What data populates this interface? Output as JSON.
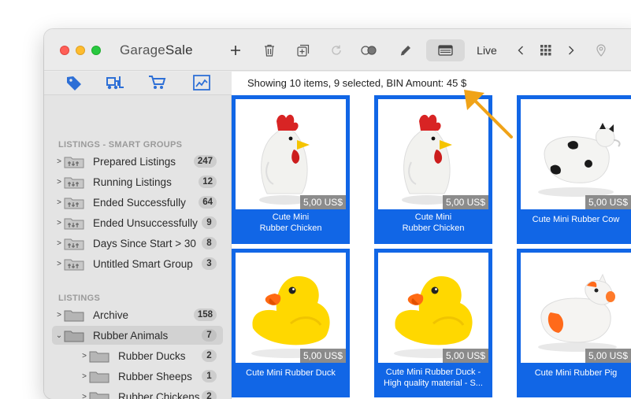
{
  "app": {
    "title_light": "Garage",
    "title_bold": "Sale",
    "live_label": "Live"
  },
  "toolbar": {
    "icons": [
      "plus-icon",
      "trash-icon",
      "duplicate-icon",
      "refresh-icon",
      "toggle-icon",
      "pencil-icon",
      "view-icon",
      "chevron-left-icon",
      "grid-icon",
      "chevron-right-icon",
      "location-icon"
    ]
  },
  "sidebar": {
    "tabs": [
      "tag-icon",
      "forklift-icon",
      "cart-icon",
      "chart-icon"
    ],
    "smart_groups_header": "LISTINGS - SMART GROUPS",
    "smart_groups": [
      {
        "label": "Prepared Listings",
        "count": "247"
      },
      {
        "label": "Running Listings",
        "count": "12"
      },
      {
        "label": "Ended Successfully",
        "count": "64"
      },
      {
        "label": "Ended Unsuccessfully",
        "count": "9"
      },
      {
        "label": "Days Since Start > 30",
        "count": "8"
      },
      {
        "label": "Untitled Smart Group",
        "count": "3"
      }
    ],
    "listings_header": "LISTINGS",
    "listings": [
      {
        "label": "Archive",
        "count": "158"
      },
      {
        "label": "Rubber Animals",
        "count": "7"
      }
    ],
    "subfolders": [
      {
        "label": "Rubber Ducks",
        "count": "2"
      },
      {
        "label": "Rubber Sheeps",
        "count": "1"
      },
      {
        "label": "Rubber Chickens",
        "count": "2"
      }
    ]
  },
  "main": {
    "status": "Showing 10 items, 9 selected, BIN Amount: 45 $",
    "items": [
      {
        "title_line1": "Cute Mini",
        "title_line2": "Rubber Chicken",
        "price": "5,00 US$",
        "kind": "chicken"
      },
      {
        "title_line1": "Cute Mini",
        "title_line2": "Rubber Chicken",
        "price": "5,00 US$",
        "kind": "chicken"
      },
      {
        "title_line1": "Cute Mini Rubber Cow",
        "title_line2": "",
        "price": "5,00 US$",
        "kind": "cow"
      },
      {
        "title_line1": "Cute Mini Rubber Duck",
        "title_line2": "",
        "price": "5,00 US$",
        "kind": "duck"
      },
      {
        "title_line1": "Cute Mini Rubber Duck -",
        "title_line2": "High quality material - S...",
        "price": "5,00 US$",
        "kind": "duck"
      },
      {
        "title_line1": "Cute Mini Rubber Pig",
        "title_line2": "",
        "price": "5,00 US$",
        "kind": "pig"
      }
    ]
  },
  "colors": {
    "selection": "#1166e6",
    "accent_arrow": "#f0a318",
    "sidebar_icon": "#2d6fd6"
  }
}
